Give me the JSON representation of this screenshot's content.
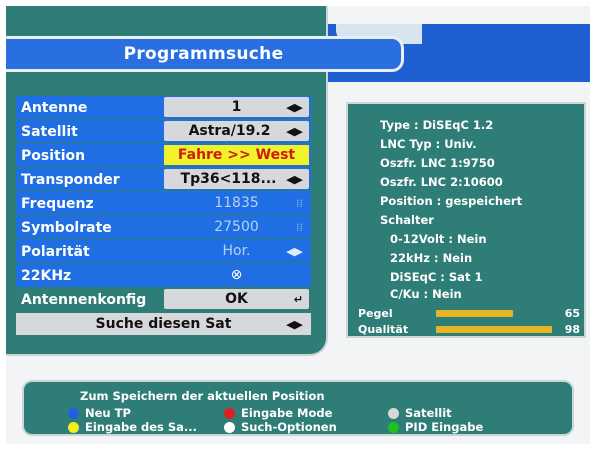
{
  "title": "Programmsuche",
  "menu": {
    "antenne": {
      "label": "Antenne",
      "value": "1"
    },
    "satellit": {
      "label": "Satellit",
      "value": "Astra/19.2"
    },
    "position": {
      "label": "Position",
      "value": "Fahre >> West"
    },
    "transponder": {
      "label": "Transponder",
      "value": "Tp36<118..."
    },
    "frequenz": {
      "label": "Frequenz",
      "value": "11835"
    },
    "symbolrate": {
      "label": "Symbolrate",
      "value": "27500"
    },
    "polaritaet": {
      "label": "Polarität",
      "value": "Hor."
    },
    "khz22": {
      "label": "22KHz",
      "value": "⊗"
    },
    "antennenkonfig": {
      "label": "Antennenkonfig",
      "value": "OK"
    },
    "search_sat": "Suche diesen Sat"
  },
  "info": {
    "type": "Type : DiSEqC 1.2",
    "lnc_typ": "LNC Typ : Univ.",
    "lnc1": "Oszfr. LNC 1:9750",
    "lnc2": "Oszfr. LNC 2:10600",
    "position": "Position : gespeichert",
    "schalter": "Schalter",
    "volt": "0-12Volt : Nein",
    "khz": "22kHz : Nein",
    "diseqc": "DiSEqC : Sat 1",
    "cku": "C/Ku : Nein",
    "pegel_label": "Pegel",
    "pegel_value": "65",
    "pegel_fraction": 0.65,
    "qualitaet_label": "Qualität",
    "qualitaet_value": "98",
    "qualitaet_fraction": 0.98
  },
  "legend": {
    "title": "Zum Speichern der aktuellen Position",
    "items": [
      {
        "label": "Neu TP",
        "color": "#2060e0"
      },
      {
        "label": "Eingabe Mode",
        "color": "#e02020"
      },
      {
        "label": "Satellit",
        "color": "#d8d8d8"
      },
      {
        "label": "Eingabe des Sa...",
        "color": "#f0f020"
      },
      {
        "label": "Such-Optionen",
        "color": "#ffffff"
      },
      {
        "label": "PID Eingabe",
        "color": "#20c020"
      }
    ]
  },
  "colors": {
    "panel": "#2e7d76",
    "highlight": "#f2f22a",
    "bar": "#e7b524"
  }
}
